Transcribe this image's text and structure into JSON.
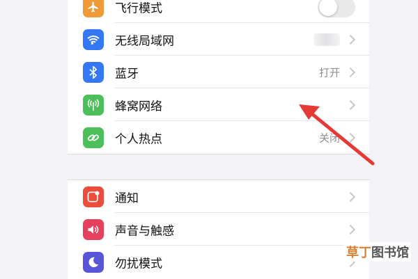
{
  "colors": {
    "page_bg": "#f2f2f7",
    "airplane": "#f09a37",
    "wifi": "#3478f6",
    "bluetooth": "#3478f6",
    "cellular": "#4cbe5a",
    "hotspot": "#4cbe5a",
    "notifications": "#eb4d3d",
    "sounds": "#e5415f",
    "focus": "#5856d6",
    "annotation_arrow": "#e53935"
  },
  "settings": {
    "group1": [
      {
        "label": "飞行模式",
        "icon": "airplane-icon",
        "control": "toggle",
        "toggle_on": false
      },
      {
        "label": "无线局域网",
        "icon": "wifi-icon",
        "value": "",
        "value_blurred": true
      },
      {
        "label": "蓝牙",
        "icon": "bluetooth-icon",
        "value": "打开"
      },
      {
        "label": "蜂窝网络",
        "icon": "cellular-icon",
        "value": ""
      },
      {
        "label": "个人热点",
        "icon": "hotspot-icon",
        "value": "关闭"
      }
    ],
    "group2": [
      {
        "label": "通知",
        "icon": "notifications-icon"
      },
      {
        "label": "声音与触感",
        "icon": "sounds-icon"
      },
      {
        "label": "勿扰模式",
        "icon": "moon-icon"
      }
    ]
  },
  "watermark": {
    "brand": "草丁",
    "site": "图书馆"
  }
}
